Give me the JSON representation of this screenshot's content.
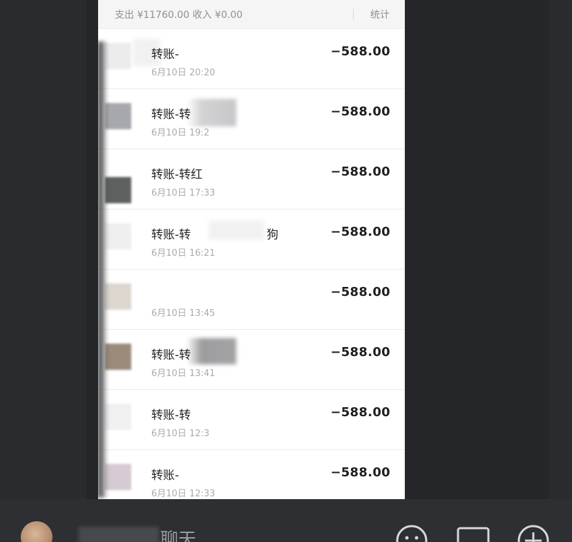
{
  "summary": {
    "text": "支出 ¥11760.00 收入 ¥0.00",
    "stats_label": "统计"
  },
  "transactions": [
    {
      "title": "转账-",
      "time": "6月10日 20:20",
      "amount": "−588.00"
    },
    {
      "title": "转账-转",
      "time": "6月10日 19:2",
      "amount": "−588.00"
    },
    {
      "title": "转账-转红",
      "time": "6月10日 17:33",
      "amount": "−588.00"
    },
    {
      "title": "转账-转",
      "suffix": "狗",
      "time": "6月10日 16:21",
      "amount": "−588.00"
    },
    {
      "title": "",
      "time": "6月10日 13:45",
      "amount": "−588.00"
    },
    {
      "title": "转账-转",
      "time": "6月10日 13:41",
      "amount": "−588.00"
    },
    {
      "title": "转账-转",
      "time": "6月10日 12:3",
      "amount": "−588.00"
    },
    {
      "title": "转账-",
      "time": "6月10日 12:33",
      "amount": "−588.00"
    }
  ],
  "bottom_bar": {
    "label": "聊天",
    "icons": [
      "emoji-icon",
      "cast-icon",
      "plus-icon"
    ]
  },
  "colors": {
    "background": "#2b2c31",
    "sheet": "#ffffff",
    "amount": "#1f1f1f",
    "time": "#ababab"
  }
}
